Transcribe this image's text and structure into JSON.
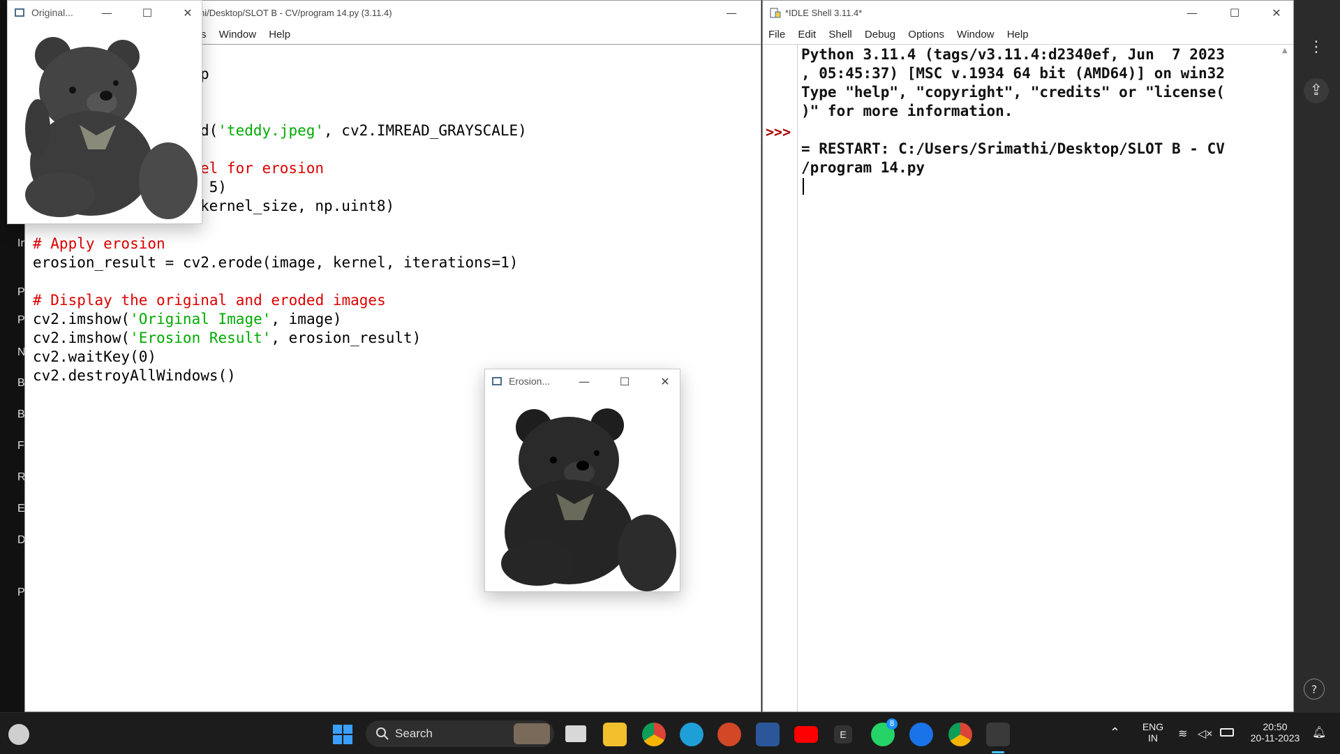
{
  "background_sidebar": {
    "items": [
      "Im",
      "Pr",
      "Py",
      "Nl",
      "Br",
      "Bi",
      "Fi",
      "Re",
      "Er",
      "De",
      "Pr"
    ]
  },
  "editor": {
    "title": "hi/Desktop/SLOT B - CV/program 14.py (3.11.4)",
    "menu": [
      "s",
      "Window",
      "Help"
    ],
    "code_lines": [
      {
        "parts": [
          {
            "t": "p",
            "c": "n"
          }
        ]
      },
      {
        "parts": [
          {
            "t": "",
            "c": "n"
          }
        ]
      },
      {
        "parts": [
          {
            "t": "",
            "c": "n"
          }
        ]
      },
      {
        "parts": [
          {
            "t": "d(",
            "c": "n"
          },
          {
            "t": "'teddy.jpeg'",
            "c": "s"
          },
          {
            "t": ", cv2.IMREAD_GRAYSCALE)",
            "c": "n"
          }
        ]
      },
      {
        "parts": [
          {
            "t": "",
            "c": "n"
          }
        ]
      },
      {
        "parts": [
          {
            "t": "el for erosion",
            "c": "c"
          }
        ]
      },
      {
        "parts": [
          {
            "t": " 5)",
            "c": "n"
          }
        ]
      },
      {
        "parts": [
          {
            "t": "kernel_size, np.uint8)",
            "c": "n"
          }
        ]
      },
      {
        "parts": [
          {
            "t": "",
            "c": "n"
          }
        ]
      },
      {
        "parts": [
          {
            "t": "# Apply erosion",
            "c": "c"
          }
        ]
      },
      {
        "parts": [
          {
            "t": "erosion_result = cv2.erode(image, kernel, iterations=1)",
            "c": "n"
          }
        ]
      },
      {
        "parts": [
          {
            "t": "",
            "c": "n"
          }
        ]
      },
      {
        "parts": [
          {
            "t": "# Display the original and eroded images",
            "c": "c"
          }
        ]
      },
      {
        "parts": [
          {
            "t": "cv2.imshow(",
            "c": "n"
          },
          {
            "t": "'Original Image'",
            "c": "s"
          },
          {
            "t": ", image)",
            "c": "n"
          }
        ]
      },
      {
        "parts": [
          {
            "t": "cv2.imshow(",
            "c": "n"
          },
          {
            "t": "'Erosion Result'",
            "c": "s"
          },
          {
            "t": ", erosion_result)",
            "c": "n"
          }
        ]
      },
      {
        "parts": [
          {
            "t": "cv2.waitKey(0)",
            "c": "n"
          }
        ]
      },
      {
        "parts": [
          {
            "t": "cv2.destroyAllWindows()",
            "c": "n"
          }
        ]
      }
    ]
  },
  "shell": {
    "title": "*IDLE Shell 3.11.4*",
    "menu": [
      "File",
      "Edit",
      "Shell",
      "Debug",
      "Options",
      "Window",
      "Help"
    ],
    "prompt": ">>>",
    "output": "Python 3.11.4 (tags/v3.11.4:d2340ef, Jun  7 2023\n, 05:45:37) [MSC v.1934 64 bit (AMD64)] on win32\nType \"help\", \"copyright\", \"credits\" or \"license(\n)\" for more information.\n\n= RESTART: C:/Users/Srimathi/Desktop/SLOT B - CV\n/program 14.py"
  },
  "original_window": {
    "title": "Original..."
  },
  "erosion_window": {
    "title": "Erosion..."
  },
  "taskbar": {
    "search_label": "Search",
    "lang_top": "ENG",
    "lang_bottom": "IN",
    "time": "20:50",
    "date": "20-11-2023",
    "whatsapp_badge": "8",
    "app_e_label": "E"
  },
  "colors": {
    "comment": "#dd0000",
    "string": "#00aa00",
    "prompt": "#aa0000"
  }
}
